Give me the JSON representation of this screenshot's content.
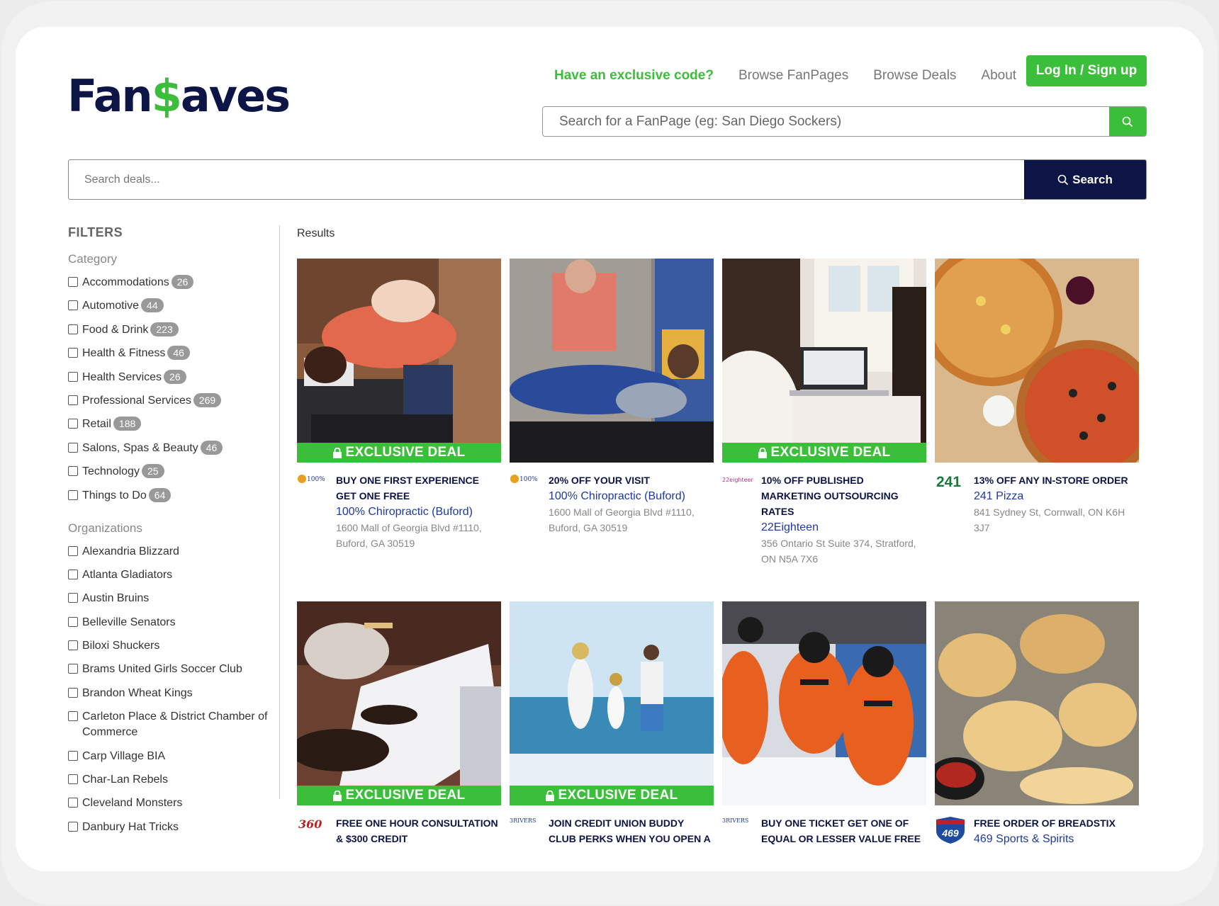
{
  "brand": {
    "logo_part1": "Fan",
    "logo_dollar": "$",
    "logo_part2": "aves"
  },
  "nav": {
    "exclusive_code": "Have an exclusive code?",
    "browse_fanpages": "Browse FanPages",
    "browse_deals": "Browse Deals",
    "about": "About",
    "login": "Log In / Sign up"
  },
  "fanpage_search": {
    "placeholder": "Search for a FanPage (eg: San Diego Sockers)"
  },
  "deal_search": {
    "placeholder": "Search deals...",
    "button": "Search"
  },
  "filters": {
    "title": "FILTERS",
    "category_label": "Category",
    "categories": [
      {
        "label": "Accommodations",
        "count": "26"
      },
      {
        "label": "Automotive",
        "count": "44"
      },
      {
        "label": "Food & Drink",
        "count": "223"
      },
      {
        "label": "Health & Fitness",
        "count": "46"
      },
      {
        "label": "Health Services",
        "count": "26"
      },
      {
        "label": "Professional Services",
        "count": "269"
      },
      {
        "label": "Retail",
        "count": "188"
      },
      {
        "label": "Salons, Spas & Beauty",
        "count": "46"
      },
      {
        "label": "Technology",
        "count": "25"
      },
      {
        "label": "Things to Do",
        "count": "64"
      }
    ],
    "organizations_label": "Organizations",
    "organizations": [
      "Alexandria Blizzard",
      "Atlanta Gladiators",
      "Austin Bruins",
      "Belleville Senators",
      "Biloxi Shuckers",
      "Brams United Girls Soccer Club",
      "Brandon Wheat Kings",
      "Carleton Place & District Chamber of Commerce",
      "Carp Village BIA",
      "Char-Lan Rebels",
      "Cleveland Monsters",
      "Danbury Hat Tricks"
    ]
  },
  "results": {
    "label": "Results",
    "exclusive_label": "EXCLUSIVE DEAL",
    "deals": [
      {
        "title": "BUY ONE FIRST EXPERIENCE GET ONE FREE",
        "vendor": "100% Chiropractic (Buford)",
        "address": "1600 Mall of Georgia Blvd #1110, Buford, GA 30519",
        "exclusive": true,
        "logo": "100%"
      },
      {
        "title": "20% OFF YOUR VISIT",
        "vendor": "100% Chiropractic (Buford)",
        "address": "1600 Mall of Georgia Blvd #1110, Buford, GA 30519",
        "exclusive": false,
        "logo": "100%"
      },
      {
        "title": "10% OFF PUBLISHED MARKETING OUTSOURCING RATES",
        "vendor": "22Eighteen",
        "address": "356 Ontario St Suite 374, Stratford, ON N5A 7X6",
        "exclusive": true,
        "logo": "22eighteen"
      },
      {
        "title": "13% OFF ANY IN-STORE ORDER",
        "vendor": "241 Pizza",
        "address": "841 Sydney St, Cornwall, ON K6H 3J7",
        "exclusive": false,
        "logo": "241"
      },
      {
        "title": "FREE ONE HOUR CONSULTATION & $300 CREDIT",
        "vendor": "",
        "address": "",
        "exclusive": true,
        "logo": "360"
      },
      {
        "title": "JOIN CREDIT UNION BUDDY CLUB PERKS WHEN YOU OPEN A",
        "vendor": "",
        "address": "",
        "exclusive": true,
        "logo": "3RIVERS"
      },
      {
        "title": "BUY ONE TICKET GET ONE OF EQUAL OR LESSER VALUE FREE",
        "vendor": "",
        "address": "",
        "exclusive": false,
        "logo": "3RIVERS"
      },
      {
        "title": "FREE ORDER OF BREADSTIX",
        "vendor": "469 Sports & Spirits",
        "address": "",
        "exclusive": false,
        "logo": "469"
      }
    ]
  },
  "colors": {
    "brand_green": "#3bbf3a",
    "brand_navy": "#0d1446",
    "link_blue": "#1e3aa0"
  },
  "icons": [
    "search-icon",
    "lock-icon"
  ]
}
